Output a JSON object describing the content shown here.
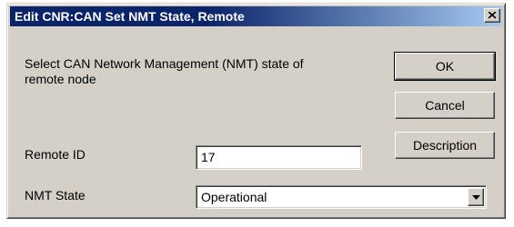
{
  "window": {
    "title": "Edit CNR:CAN Set NMT State, Remote",
    "close_icon": "close-icon"
  },
  "content": {
    "prompt": "Select CAN Network Management (NMT) state of remote node",
    "remote_id_label": "Remote ID",
    "remote_id_value": "17",
    "nmt_state_label": "NMT State",
    "nmt_state_value": "Operational",
    "dropdown_icon": "chevron-down-icon"
  },
  "buttons": {
    "ok": "OK",
    "cancel": "Cancel",
    "description": "Description"
  },
  "colors": {
    "title_bar_start": "#0a246a",
    "title_bar_end": "#a6caf0",
    "face": "#d4d0c8"
  }
}
